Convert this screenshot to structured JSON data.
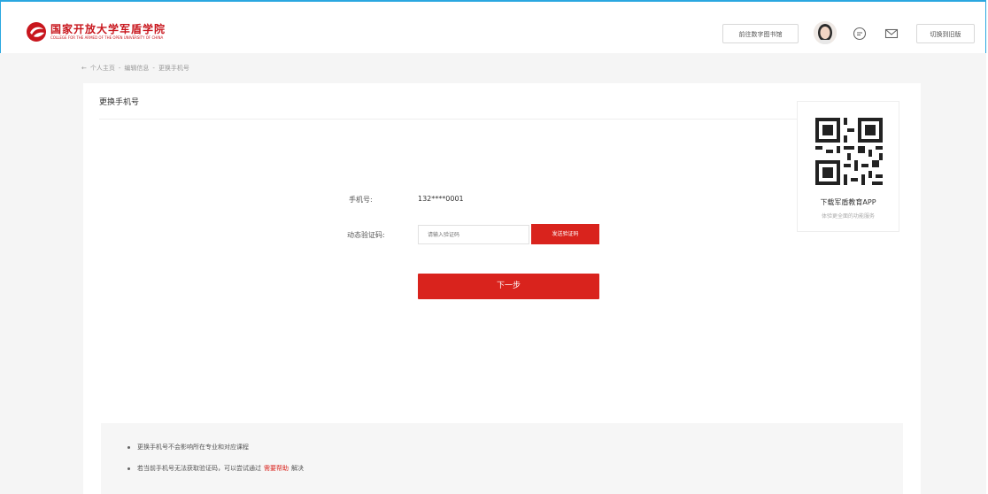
{
  "header": {
    "logo_title": "国家开放大学军盾学院",
    "logo_subtitle": "COLLEGE FOR THE ARMED OF THE OPEN UNIVERSITY OF CHINA",
    "app_button": "前往数字图书馆",
    "switch_button": "切换到旧版",
    "brand_color": "#c8161d"
  },
  "breadcrumb": {
    "items": [
      "个人主页",
      "编辑信息",
      "更换手机号"
    ],
    "separator": "-"
  },
  "panel": {
    "title": "更换手机号"
  },
  "form": {
    "phone_label": "手机号:",
    "phone_value": "132****0001",
    "code_label": "动态验证码:",
    "code_placeholder": "请输入验证码",
    "send_code_button": "发送验证码",
    "next_button": "下一步",
    "accent_color": "#d9231d"
  },
  "qr": {
    "title": "下载军盾教育APP",
    "subtitle": "体验更全面的功能服务"
  },
  "tips": {
    "tip1": "更换手机号不会影响所在专业和对应课程",
    "tip2_prefix": "若当前手机号无法获取验证码，可以尝试通过",
    "tip2_link": "需要帮助",
    "tip2_suffix": "解决"
  }
}
